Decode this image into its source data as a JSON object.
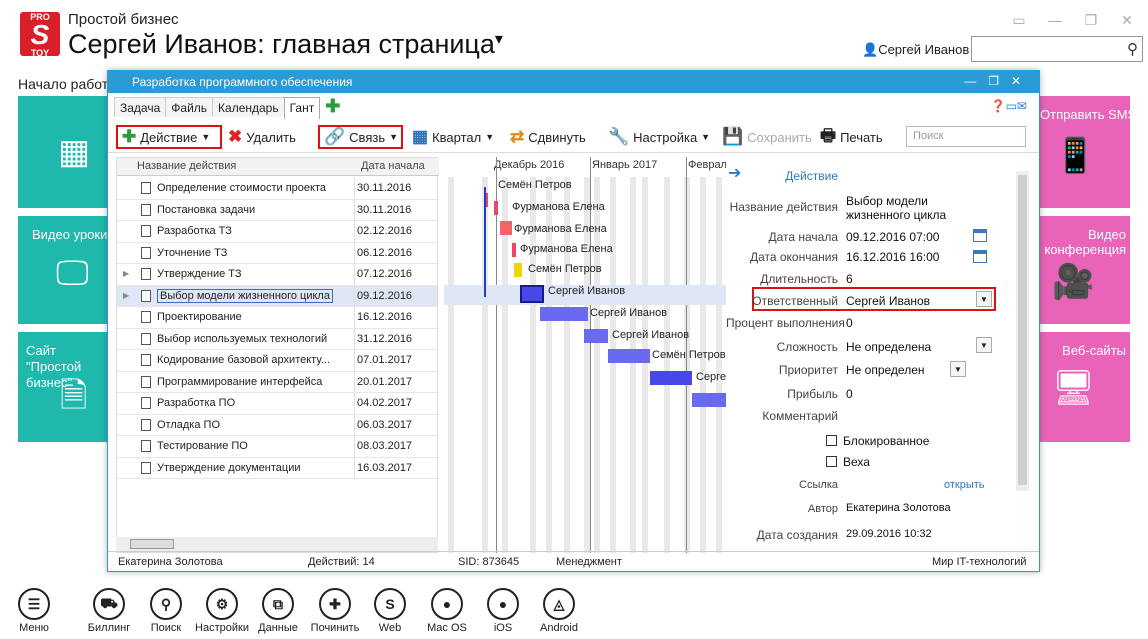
{
  "app": {
    "logo_top": "PRO",
    "logo_bottom": "TOY",
    "subtitle": "Простой бизнес",
    "title": "Сергей Иванов: главная страница",
    "title_caret": "▾",
    "user": "Сергей Иванов",
    "home_link": "Начало работы"
  },
  "tiles": {
    "video": "Видео уроки",
    "site": "Сайт \"Простой бизнес\"",
    "sms": "Отправить SMS",
    "conference": "Видео конференция",
    "websites": "Веб-сайты"
  },
  "dialog": {
    "title": "Разработка программного обеспечения",
    "tabs": [
      "Задача",
      "Файль",
      "Календарь",
      "Гант"
    ],
    "active_tab": "Гант",
    "toolbar": {
      "action": "Действие",
      "delete": "Удалить",
      "link": "Связь",
      "quarter": "Квартал",
      "shift": "Сдвинуть",
      "settings": "Настройка",
      "save": "Сохранить",
      "print": "Печать",
      "search_placeholder": "Поиск"
    },
    "grid": {
      "col_name": "Название действия",
      "col_start": "Дата начала",
      "rows": [
        {
          "name": "Определение стоимости проекта",
          "date": "30.11.2016"
        },
        {
          "name": "Постановка задачи",
          "date": "30.11.2016"
        },
        {
          "name": "Разработка ТЗ",
          "date": "02.12.2016"
        },
        {
          "name": "Уточнение ТЗ",
          "date": "06.12.2016"
        },
        {
          "name": "Утверждение ТЗ",
          "date": "07.12.2016"
        },
        {
          "name": "Выбор модели жизненного цикла",
          "date": "09.12.2016"
        },
        {
          "name": "Проектирование",
          "date": "16.12.2016"
        },
        {
          "name": "Выбор используемых технологий",
          "date": "31.12.2016"
        },
        {
          "name": "Кодирование базовой архитекту...",
          "date": "07.01.2017"
        },
        {
          "name": "Программирование интерфейса",
          "date": "20.01.2017"
        },
        {
          "name": "Разработка ПО",
          "date": "04.02.2017"
        },
        {
          "name": "Отладка ПО",
          "date": "06.03.2017"
        },
        {
          "name": "Тестирование ПО",
          "date": "08.03.2017"
        },
        {
          "name": "Утверждение документации",
          "date": "16.03.2017"
        }
      ]
    },
    "gantt": {
      "months": [
        "Декабрь 2016",
        "Январь 2017",
        "Февраль"
      ],
      "labels": [
        "Семён Петров",
        "Фурманова Елена",
        "Фурманова Елена",
        "Фурманова Елена",
        "Семён Петров",
        "Сергей Иванов",
        "Сергей Иванов",
        "Сергей Иванов",
        "Семён Петров",
        "Серге..."
      ]
    },
    "props": {
      "section": "Действие",
      "name_label": "Название действия",
      "name_value": "Выбор модели жизненного цикла",
      "start_label": "Дата начала",
      "start_value": "09.12.2016 07:00",
      "end_label": "Дата окончания",
      "end_value": "16.12.2016 16:00",
      "duration_label": "Длительность",
      "duration_value": "6",
      "responsible_label": "Ответственный",
      "responsible_value": "Сергей Иванов",
      "percent_label": "Процент выполнения",
      "percent_value": "0",
      "complexity_label": "Сложность",
      "complexity_value": "Не определена",
      "priority_label": "Приоритет",
      "priority_value": "Не определен",
      "profit_label": "Прибыль",
      "profit_value": "0",
      "comment_label": "Комментарий",
      "blocked_label": "Блокированное",
      "milestone_label": "Веха",
      "link_label": "Ссылка",
      "link_value": "открыть",
      "author_label": "Автор",
      "author_value": "Екатерина Золотова",
      "created_label": "Дата создания",
      "created_value": "29.09.2016 10:32"
    },
    "status": {
      "user": "Екатерина Золотова",
      "actions": "Действий: 14",
      "sid": "SID: 873645",
      "role": "Менеджмент",
      "company": "Мир IT-технологий"
    }
  },
  "bottom": [
    "Меню",
    "Биллинг",
    "Поиск",
    "Настройки",
    "Данные",
    "Починить",
    "Web",
    "Mac OS",
    "iOS",
    "Android"
  ]
}
